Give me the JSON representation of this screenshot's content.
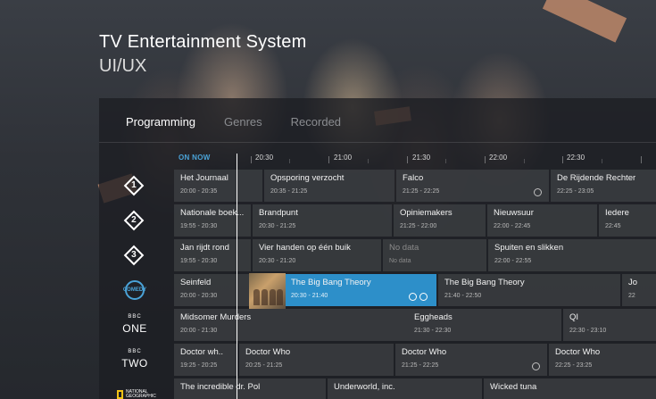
{
  "header": {
    "title": "TV Entertainment System",
    "subtitle": "UI/UX"
  },
  "tabs": [
    {
      "label": "Programming",
      "active": true
    },
    {
      "label": "Genres",
      "active": false
    },
    {
      "label": "Recorded",
      "active": false
    }
  ],
  "timeline": {
    "on_now": "ON NOW",
    "times": [
      "20:30",
      "21:00",
      "21:30",
      "22:00",
      "22:30"
    ]
  },
  "accent_color": "#2d8fc9",
  "channels": [
    {
      "logo": {
        "type": "npo",
        "text": "1"
      },
      "programs": [
        {
          "title": "Het Journaal",
          "time": "20:00 - 20:35"
        },
        {
          "title": "Opsporing verzocht",
          "time": "20:35 - 21:25"
        },
        {
          "title": "Falco",
          "time": "21:25 - 22:25",
          "icon": "more-icon"
        },
        {
          "title": "De Rijdende Rechter",
          "time": "22:25 - 23:05"
        }
      ]
    },
    {
      "logo": {
        "type": "npo",
        "text": "2"
      },
      "programs": [
        {
          "title": "Nationale boek...",
          "time": "19:55 - 20:30"
        },
        {
          "title": "Brandpunt",
          "time": "20:30 - 21:25"
        },
        {
          "title": "Opiniemakers",
          "time": "21:25 - 22:00"
        },
        {
          "title": "Nieuwsuur",
          "time": "22:00 - 22:45"
        },
        {
          "title": "Iedere",
          "time": "22:45"
        }
      ]
    },
    {
      "logo": {
        "type": "npo",
        "text": "3"
      },
      "programs": [
        {
          "title": "Jan rijdt rond",
          "time": "19:55 - 20:30"
        },
        {
          "title": "Vier handen op één buik",
          "time": "20:30 - 21:20"
        },
        {
          "title": "No data",
          "time": "No data"
        },
        {
          "title": "Spuiten en slikken",
          "time": "22:00 - 22:55"
        }
      ]
    },
    {
      "logo": {
        "type": "comedy",
        "text": "COMEDY"
      },
      "programs": [
        {
          "title": "Seinfeld",
          "time": "20:00 - 20:30"
        },
        {
          "title": "The Big Bang Theory",
          "time": "20:30 - 21:40",
          "highlight": true
        },
        {
          "title": "The Big Bang Theory",
          "time": "21:40 - 22:50"
        },
        {
          "title": "Jo",
          "time": "22"
        }
      ]
    },
    {
      "logo": {
        "type": "bbc",
        "text": "ONE"
      },
      "programs": [
        {
          "title": "Midsomer Murders",
          "time": "20:00 - 21:30"
        },
        {
          "title": "Eggheads",
          "time": "21:30 - 22:30"
        },
        {
          "title": "QI",
          "time": "22:30 - 23:10"
        }
      ]
    },
    {
      "logo": {
        "type": "bbc",
        "text": "TWO"
      },
      "programs": [
        {
          "title": "Doctor wh..",
          "time": "19:25 - 20:25"
        },
        {
          "title": "Doctor Who",
          "time": "20:25 - 21:25"
        },
        {
          "title": "Doctor Who",
          "time": "21:25 - 22:25",
          "icon": "clock-icon"
        },
        {
          "title": "Doctor Who",
          "time": "22:25 - 23:25"
        }
      ]
    },
    {
      "logo": {
        "type": "natgeo",
        "text": "NATIONAL GEOGRAPHIC"
      },
      "programs": [
        {
          "title": "The incredible dr. Pol",
          "time": ""
        },
        {
          "title": "Underworld, inc.",
          "time": ""
        },
        {
          "title": "Wicked tuna",
          "time": ""
        }
      ]
    }
  ]
}
